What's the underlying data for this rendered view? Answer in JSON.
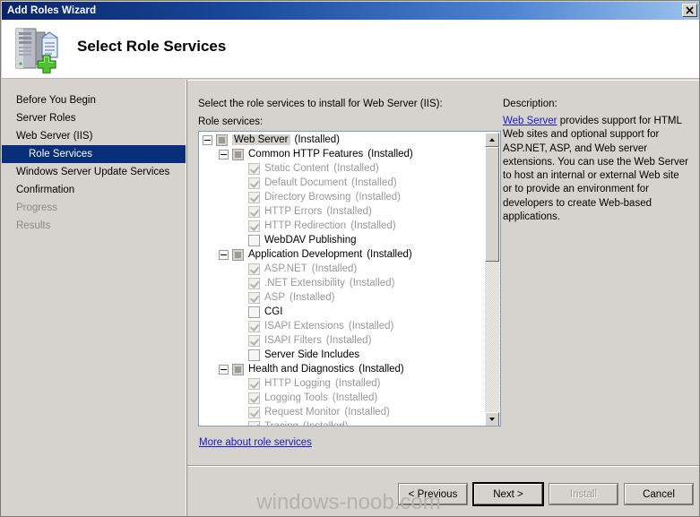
{
  "window": {
    "title": "Add Roles Wizard",
    "close_label": "✕"
  },
  "header": {
    "title": "Select Role Services",
    "icon": "server-add-icon"
  },
  "sidebar": {
    "items": [
      {
        "label": "Before You Begin",
        "state": "normal",
        "level": 0
      },
      {
        "label": "Server Roles",
        "state": "normal",
        "level": 0
      },
      {
        "label": "Web Server (IIS)",
        "state": "normal",
        "level": 0
      },
      {
        "label": "Role Services",
        "state": "selected",
        "level": 1
      },
      {
        "label": "Windows Server Update Services",
        "state": "normal",
        "level": 0
      },
      {
        "label": "Confirmation",
        "state": "normal",
        "level": 0
      },
      {
        "label": "Progress",
        "state": "disabled",
        "level": 0
      },
      {
        "label": "Results",
        "state": "disabled",
        "level": 0
      }
    ]
  },
  "main": {
    "intro": "Select the role services to install for Web Server (IIS):",
    "role_services_label": "Role services:",
    "more_link": "More about role services",
    "tree": [
      {
        "label": "Web Server",
        "suffix": "(Installed)",
        "indent": 1,
        "expander": true,
        "checkbox": "indeterminate",
        "dim": false,
        "selected": true
      },
      {
        "label": "Common HTTP Features",
        "suffix": "(Installed)",
        "indent": 2,
        "expander": true,
        "checkbox": "indeterminate",
        "dim": false,
        "selected": false
      },
      {
        "label": "Static Content",
        "suffix": "(Installed)",
        "indent": 3,
        "expander": false,
        "checkbox": "checked-dim",
        "dim": true,
        "selected": false
      },
      {
        "label": "Default Document",
        "suffix": "(Installed)",
        "indent": 3,
        "expander": false,
        "checkbox": "checked-dim",
        "dim": true,
        "selected": false
      },
      {
        "label": "Directory Browsing",
        "suffix": "(Installed)",
        "indent": 3,
        "expander": false,
        "checkbox": "checked-dim",
        "dim": true,
        "selected": false
      },
      {
        "label": "HTTP Errors",
        "suffix": "(Installed)",
        "indent": 3,
        "expander": false,
        "checkbox": "checked-dim",
        "dim": true,
        "selected": false
      },
      {
        "label": "HTTP Redirection",
        "suffix": "(Installed)",
        "indent": 3,
        "expander": false,
        "checkbox": "checked-dim",
        "dim": true,
        "selected": false
      },
      {
        "label": "WebDAV Publishing",
        "suffix": "",
        "indent": 3,
        "expander": false,
        "checkbox": "empty",
        "dim": false,
        "selected": false
      },
      {
        "label": "Application Development",
        "suffix": "(Installed)",
        "indent": 2,
        "expander": true,
        "checkbox": "indeterminate",
        "dim": false,
        "selected": false
      },
      {
        "label": "ASP.NET",
        "suffix": "(Installed)",
        "indent": 3,
        "expander": false,
        "checkbox": "checked-dim",
        "dim": true,
        "selected": false
      },
      {
        "label": ".NET Extensibility",
        "suffix": "(Installed)",
        "indent": 3,
        "expander": false,
        "checkbox": "checked-dim",
        "dim": true,
        "selected": false
      },
      {
        "label": "ASP",
        "suffix": "(Installed)",
        "indent": 3,
        "expander": false,
        "checkbox": "checked-dim",
        "dim": true,
        "selected": false
      },
      {
        "label": "CGI",
        "suffix": "",
        "indent": 3,
        "expander": false,
        "checkbox": "empty",
        "dim": false,
        "selected": false
      },
      {
        "label": "ISAPI Extensions",
        "suffix": "(Installed)",
        "indent": 3,
        "expander": false,
        "checkbox": "checked-dim",
        "dim": true,
        "selected": false
      },
      {
        "label": "ISAPI Filters",
        "suffix": "(Installed)",
        "indent": 3,
        "expander": false,
        "checkbox": "checked-dim",
        "dim": true,
        "selected": false
      },
      {
        "label": "Server Side Includes",
        "suffix": "",
        "indent": 3,
        "expander": false,
        "checkbox": "empty",
        "dim": false,
        "selected": false
      },
      {
        "label": "Health and Diagnostics",
        "suffix": "(Installed)",
        "indent": 2,
        "expander": true,
        "checkbox": "indeterminate",
        "dim": false,
        "selected": false
      },
      {
        "label": "HTTP Logging",
        "suffix": "(Installed)",
        "indent": 3,
        "expander": false,
        "checkbox": "checked-dim",
        "dim": true,
        "selected": false
      },
      {
        "label": "Logging Tools",
        "suffix": "(Installed)",
        "indent": 3,
        "expander": false,
        "checkbox": "checked-dim",
        "dim": true,
        "selected": false
      },
      {
        "label": "Request Monitor",
        "suffix": "(Installed)",
        "indent": 3,
        "expander": false,
        "checkbox": "checked-dim",
        "dim": true,
        "selected": false
      },
      {
        "label": "Tracing",
        "suffix": "(Installed)",
        "indent": 3,
        "expander": false,
        "checkbox": "checked-dim",
        "dim": true,
        "selected": false
      }
    ]
  },
  "description": {
    "heading": "Description:",
    "link_text": "Web Server",
    "body": " provides support for HTML Web sites and optional support for ASP.NET, ASP, and Web server extensions. You can use the Web Server to host an internal or external Web site or to provide an environment for developers to create Web-based applications."
  },
  "footer": {
    "previous_label": "< Previous",
    "next_label": "Next >",
    "install_label": "Install",
    "cancel_label": "Cancel"
  },
  "watermark": {
    "text": "windows-noob.com"
  },
  "colors": {
    "titlebar_start": "#0a246a",
    "titlebar_end": "#9dc3ee",
    "selection": "#0a2f7a",
    "dialog_face": "#d6d3ce",
    "link": "#1919c4",
    "disabled_text": "#9a9a94"
  }
}
